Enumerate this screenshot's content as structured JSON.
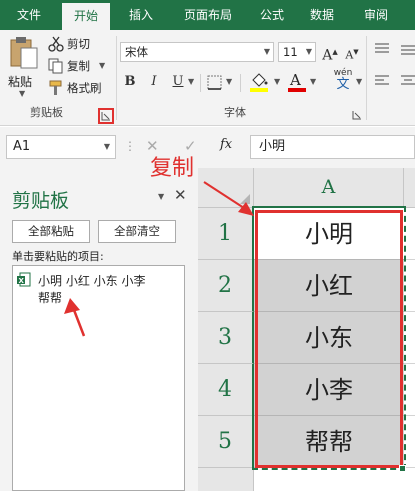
{
  "tabs": [
    {
      "label": "文件",
      "active": false
    },
    {
      "label": "开始",
      "active": true
    },
    {
      "label": "插入",
      "active": false
    },
    {
      "label": "页面布局",
      "active": false
    },
    {
      "label": "公式",
      "active": false
    },
    {
      "label": "数据",
      "active": false
    },
    {
      "label": "审阅",
      "active": false
    }
  ],
  "ribbon": {
    "paste_label": "粘贴",
    "cut_label": "剪切",
    "copy_label": "复制",
    "format_painter_label": "格式刷",
    "clipboard_group": "剪贴板",
    "font_name": "宋体",
    "font_size": "11",
    "grow_font": "A",
    "shrink_font": "A",
    "bold": "B",
    "italic": "I",
    "underline": "U",
    "font_color_letter": "A",
    "phonetic": "wén",
    "font_group": "字体",
    "accent_color": "#217346",
    "highlight_color": "#ffff00",
    "font_color": "#e00000"
  },
  "formula_bar": {
    "name_box": "A1",
    "fx_label": "fx",
    "content": "小明"
  },
  "clipboard_pane": {
    "title": "剪贴板",
    "paste_all": "全部粘贴",
    "clear_all": "全部清空",
    "instruction": "单击要粘贴的项目:",
    "items": [
      {
        "line1": "小明  小红  小东  小李",
        "line2": "帮帮"
      }
    ]
  },
  "sheet": {
    "column_header": "A",
    "rows": [
      {
        "num": "1",
        "value": "小明"
      },
      {
        "num": "2",
        "value": "小红"
      },
      {
        "num": "3",
        "value": "小东"
      },
      {
        "num": "4",
        "value": "小李"
      },
      {
        "num": "5",
        "value": "帮帮"
      }
    ]
  },
  "annotation": {
    "copy_text": "复制",
    "color": "#e0312f"
  }
}
